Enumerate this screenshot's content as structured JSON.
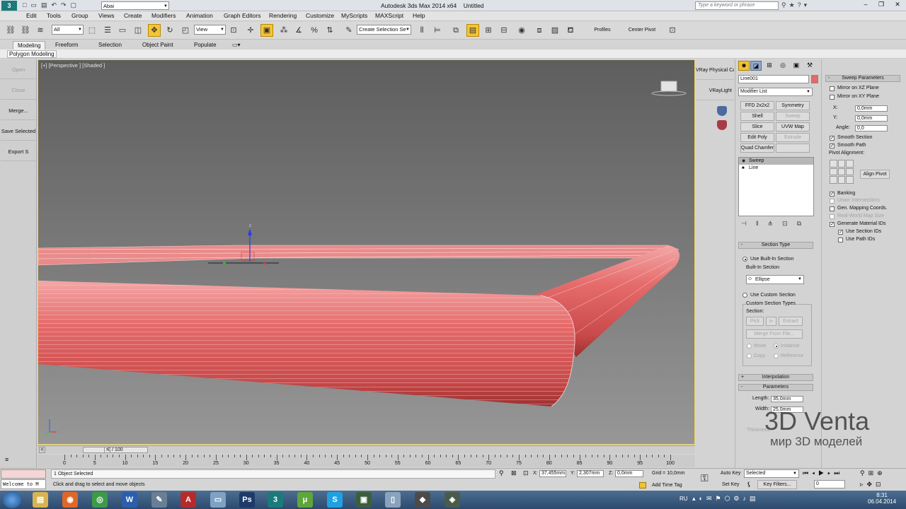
{
  "titlebar": {
    "workspace": "Abai",
    "title": "Autodesk 3ds Max  2014 x64",
    "doc": "Untitled",
    "search_placeholder": "Type a keyword or phrase"
  },
  "menu": [
    "Edit",
    "Tools",
    "Group",
    "Views",
    "Create",
    "Modifiers",
    "Animation",
    "Graph Editors",
    "Rendering",
    "Customize",
    "MyScripts",
    "MAXScript",
    "Help"
  ],
  "toolbar": {
    "filter": "All",
    "coord": "View",
    "selection_set": "Create Selection Se",
    "profiles": "Profiles",
    "center_pivot": "Center Pivot"
  },
  "ribbon": {
    "tabs": [
      "Modeling",
      "Freeform",
      "Selection",
      "Object Paint",
      "Populate"
    ],
    "sub": "Polygon Modeling"
  },
  "left_panel": {
    "buttons": [
      "Open",
      "Close",
      "Merge...",
      "Save Selected",
      "Export S"
    ]
  },
  "viewport": {
    "label": "[+] [Perspective ] [Shaded ]"
  },
  "mid_panel": {
    "items": [
      "VRay Physical Car",
      "VRayLight"
    ]
  },
  "command_panel": {
    "object_name": "Line001",
    "modifier_list": "Modifier List",
    "mod_buttons": [
      "FFD 2x2x2",
      "Symmetry",
      "Shell",
      "Sweep",
      "Slice",
      "UVW Map",
      "Edit Poly",
      "Extrude",
      "Quad Chamfer",
      ""
    ],
    "stack": [
      "Sweep",
      "Line"
    ],
    "section_type": {
      "header": "Section Type",
      "use_builtin": "Use Built-In Section",
      "builtin_label": "Built-In Section",
      "builtin_value": "Ellipse",
      "use_custom": "Use Custom Section",
      "custom_types": "Custom Section Types",
      "section": "Section:",
      "pick": "Pick",
      "extract": "Extract",
      "merge": "Merge From File...",
      "move": "Move",
      "instance": "Instance",
      "copy": "Copy",
      "reference": "Reference"
    },
    "interpolation": "Interpolation",
    "parameters": {
      "header": "Parameters",
      "length_label": "Length:",
      "length": "35,0mm",
      "width_label": "Width:",
      "width": "25,0mm",
      "thickness_label": "Thickness:"
    }
  },
  "sweep_params": {
    "header": "Sweep Parameters",
    "mirror_xz": "Mirror on XZ Plane",
    "mirror_xy": "Mirror on XY Plane",
    "x_label": "X:",
    "x": "0,0mm",
    "y_label": "Y:",
    "y": "0,0mm",
    "angle_label": "Angle:",
    "angle": "0,0",
    "smooth_section": "Smooth Section",
    "smooth_path": "Smooth Path",
    "pivot_alignment": "Pivot Alignment:",
    "align_pivot": "Align Pivot",
    "banking": "Banking",
    "union": "Union Intersections",
    "gen_mapping": "Gen. Mapping Coords.",
    "real_world": "Real-World Map Size",
    "gen_material": "Generate Material IDs",
    "use_section_ids": "Use Section IDs",
    "use_path_ids": "Use Path IDs"
  },
  "timeline": {
    "slider": "0 / 100",
    "ticks": [
      "0",
      "5",
      "10",
      "15",
      "20",
      "25",
      "30",
      "35",
      "40",
      "45",
      "50",
      "55",
      "60",
      "65",
      "70",
      "75",
      "80",
      "85",
      "90",
      "95",
      "100"
    ]
  },
  "status": {
    "welcome": "Welcome to M",
    "selected": "1 Object Selected",
    "prompt": "Click and drag to select and move objects",
    "x_label": "X:",
    "x": "37,455mm",
    "y_label": "Y:",
    "y": "2,307mm",
    "z_label": "Z:",
    "z": "0,0mm",
    "grid": "Grid = 10,0mm",
    "add_time_tag": "Add Time Tag",
    "auto_key": "Auto Key",
    "selected_combo": "Selected",
    "set_key": "Set Key",
    "key_filters": "Key Filters...",
    "frame": "0"
  },
  "taskbar": {
    "lang": "RU",
    "time": "8:31",
    "date": "06.04.2014"
  },
  "watermark": {
    "line1": "3D Venta",
    "line2": "мир 3D моделей"
  }
}
